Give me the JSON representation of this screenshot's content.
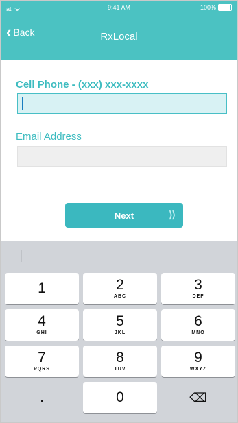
{
  "status_bar": {
    "signal": "atl ᯤ",
    "time": "9:41 AM",
    "battery": "100%"
  },
  "nav": {
    "back_label": "Back",
    "title": "RxLocal"
  },
  "form": {
    "phone_label": "Cell Phone - (xxx) xxx-xxxx",
    "phone_value": "",
    "email_label": "Email Address",
    "email_value": "",
    "next_label": "Next",
    "next_arrows": "⟩⟩"
  },
  "keypad": {
    "rows": [
      [
        {
          "num": "1",
          "letters": ""
        },
        {
          "num": "2",
          "letters": "ABC"
        },
        {
          "num": "3",
          "letters": "DEF"
        }
      ],
      [
        {
          "num": "4",
          "letters": "GHI"
        },
        {
          "num": "5",
          "letters": "JKL"
        },
        {
          "num": "6",
          "letters": "MNO"
        }
      ],
      [
        {
          "num": "7",
          "letters": "PQRS"
        },
        {
          "num": "8",
          "letters": "TUV"
        },
        {
          "num": "9",
          "letters": "WXYZ"
        }
      ],
      [
        {
          "num": ".",
          "letters": ""
        },
        {
          "num": "0",
          "letters": ""
        },
        {
          "num": "⌫",
          "letters": ""
        }
      ]
    ]
  },
  "colors": {
    "accent": "#4bc2c2",
    "input_focus": "#d8f2f4",
    "keyboard_bg": "#d1d4d9"
  }
}
